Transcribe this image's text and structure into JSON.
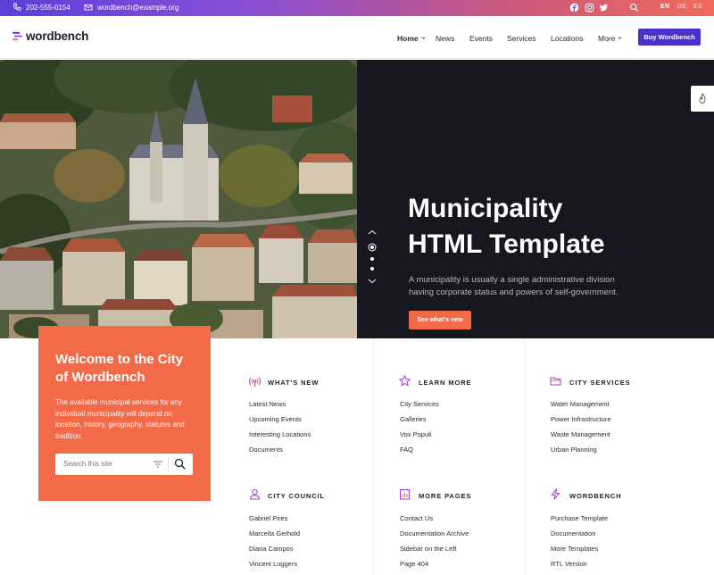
{
  "topbar": {
    "phone": "202-555-0154",
    "email": "wordbench@example.org",
    "social_icons": [
      "facebook-icon",
      "instagram-icon",
      "twitter-icon"
    ],
    "languages": [
      "EN",
      "DE",
      "ES"
    ],
    "active_language": "EN"
  },
  "header": {
    "logo_text": "wordbench",
    "nav": [
      "Home",
      "News",
      "Events",
      "Services",
      "Locations",
      "More"
    ],
    "buy_label": "Buy Wordbench"
  },
  "hero": {
    "title_line1": "Municipality",
    "title_line2": "HTML Template",
    "subtitle": "A municipality is usually a single administrative division having corporate status and powers of self-government.",
    "cta": "See what's new",
    "slide_count": 3,
    "active_slide": 1
  },
  "welcome": {
    "title": "Welcome to the City of Wordbench",
    "text": "The available municipal services for any individual municipality will depend on location, history, geography, statutes and tradition.",
    "search_placeholder": "Search this site"
  },
  "columns": [
    {
      "title": "What's new",
      "icon": "broadcast-icon",
      "links": [
        "Latest News",
        "Upcoming Events",
        "Interesting Locations",
        "Documents"
      ]
    },
    {
      "title": "Learn more",
      "icon": "star-icon",
      "links": [
        "City Services",
        "Galleries",
        "Vox Populi",
        "FAQ"
      ]
    },
    {
      "title": "City services",
      "icon": "folder-icon",
      "links": [
        "Water Management",
        "Power Infrastructure",
        "Waste Management",
        "Urban Planning"
      ]
    },
    {
      "title": "City council",
      "icon": "person-icon",
      "links": [
        "Gabriel Pires",
        "Marcella Gerhold",
        "Diana Campos",
        "Vincent Luggers"
      ]
    },
    {
      "title": "More pages",
      "icon": "chart-document-icon",
      "links": [
        "Contact Us",
        "Documentation Archive",
        "Sidebar on the Left",
        "Page 404"
      ]
    },
    {
      "title": "Wordbench",
      "icon": "bolt-icon",
      "links": [
        "Purchase Template",
        "Documentation",
        "More Templates",
        "RTL Version"
      ]
    }
  ],
  "colors": {
    "accent": "#f26a48",
    "brand": "#4b31c9",
    "hero_bg": "#17171f",
    "icon": "#9b3fd0"
  }
}
